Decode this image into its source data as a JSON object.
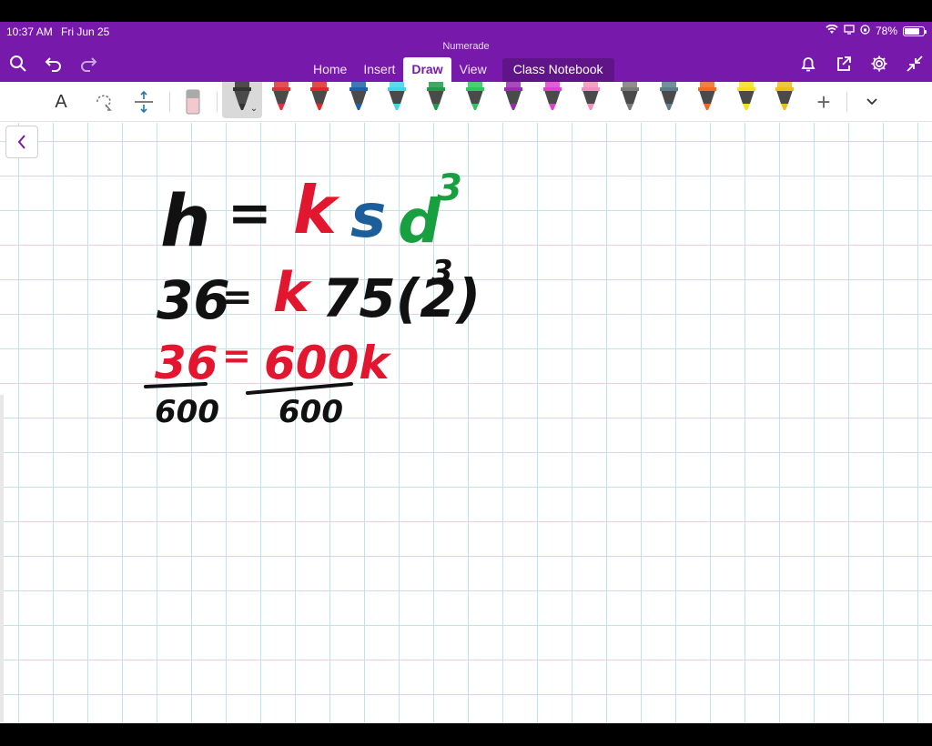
{
  "status": {
    "time": "10:37 AM",
    "date": "Fri Jun 25",
    "battery": "78%",
    "battery_level": 0.78
  },
  "app_title": "Numerade",
  "tabs": [
    {
      "label": "Home"
    },
    {
      "label": "Insert"
    },
    {
      "label": "Draw",
      "active": true
    },
    {
      "label": "View"
    },
    {
      "label": "Class Notebook"
    }
  ],
  "ribbon": {
    "text_tool": "A",
    "pens": [
      {
        "name": "black-pen",
        "color": "#333333"
      },
      {
        "name": "red-pen",
        "color": "#e0303a"
      },
      {
        "name": "red-marker",
        "color": "#e3262b"
      },
      {
        "name": "blue-pen",
        "color": "#1e5faa"
      },
      {
        "name": "cyan-highlighter",
        "color": "#3ed6e8"
      },
      {
        "name": "green-pen",
        "color": "#1f9a4a"
      },
      {
        "name": "green-highlighter",
        "color": "#2cc75a"
      },
      {
        "name": "purple-pen",
        "color": "#9a2ab0"
      },
      {
        "name": "magenta-pen",
        "color": "#e040d0"
      },
      {
        "name": "pink-highlighter",
        "color": "#f28fbf"
      },
      {
        "name": "gray-pen",
        "color": "#7a7a7a"
      },
      {
        "name": "steel-pen",
        "color": "#5c7c8a"
      },
      {
        "name": "orange-pen",
        "color": "#f06a20"
      },
      {
        "name": "yellow-highlighter",
        "color": "#f5e01c"
      },
      {
        "name": "gold-highlighter",
        "color": "#e8c018"
      }
    ],
    "add": "+"
  },
  "ink": {
    "line1": {
      "h": "h",
      "eq": "=",
      "k": "k",
      "s": "s",
      "d": "d",
      "exp": "3"
    },
    "line2": {
      "lhs": "36",
      "eq": "=",
      "k": "k",
      "rest": "75(2)",
      "exp": "3"
    },
    "line3": {
      "num_left": "36",
      "den_left": "600",
      "eq": "=",
      "num_right": "600k",
      "den_right": "600"
    },
    "colors": {
      "black": "#111111",
      "red": "#e3162f",
      "blue": "#1b5e9a",
      "green": "#18a040"
    }
  },
  "colors": {
    "accent": "#7719aa"
  }
}
